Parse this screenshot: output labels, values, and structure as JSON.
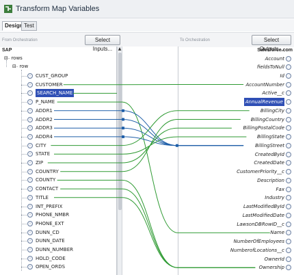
{
  "window": {
    "title": "Transform Map Variables"
  },
  "tabs": [
    {
      "label": "Design",
      "active": true
    },
    {
      "label": "Test",
      "active": false
    }
  ],
  "from_label": "From Orchestration",
  "to_label": "To Orchestration",
  "select_inputs": "Select Inputs...",
  "select_outputs": "Select Outputs...",
  "left": {
    "root": "SAP",
    "rows_label": "rows",
    "row_label": "row",
    "fields": [
      "CUST_GROUP",
      "CUSTOMER",
      "SEARCH_NAME",
      "P_NAME",
      "ADDR1",
      "ADDR2",
      "ADDR3",
      "ADDR4",
      "CITY",
      "STATE",
      "ZIP",
      "COUNTRY",
      "COUNTY",
      "CONTACT",
      "TITLE",
      "INT_PREFIX",
      "PHONE_NMBR",
      "PHONE_EXT",
      "DUNN_CD",
      "DUNN_DATE",
      "DUNN_NUMBER",
      "HOLD_CODE",
      "OPEN_ORDS"
    ],
    "selected": "SEARCH_NAME"
  },
  "right": {
    "root": "Salesforce.com",
    "account_label": "Account",
    "fields": [
      "fieldsToNull",
      "Id",
      "AccountNumber",
      "Active__c",
      "AnnualRevenue",
      "BillingCity",
      "BillingCountry",
      "BillingPostalCode",
      "BillingState",
      "BillingStreet",
      "CreatedById",
      "CreatedDate",
      "CustomerPriority__c",
      "Description",
      "Fax",
      "Industry",
      "LastModifiedById",
      "LastModifiedDate",
      "LawsonDBRowID__c",
      "Name",
      "NumberOfEmployees",
      "NumberofLocations__c",
      "OwnerId",
      "Ownership"
    ],
    "selected": "AnnualRevenue"
  },
  "colors": {
    "green": "#2e9a32",
    "blue": "#1f5fa8",
    "selection": "#2f4fb5"
  }
}
